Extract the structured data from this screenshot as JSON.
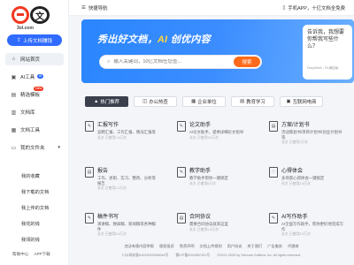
{
  "logo": {
    "mark_text": "文",
    "sub": "3ol.com"
  },
  "sidebar": {
    "upload_label": "上传文档赚钱",
    "items": [
      {
        "label": "网站首页",
        "icon": "home-icon"
      },
      {
        "label": "AI工具",
        "icon": "ai-icon",
        "badge": "AI"
      },
      {
        "label": "精选模板",
        "icon": "template-icon",
        "badge": "New"
      },
      {
        "label": "文档库",
        "icon": "library-icon"
      },
      {
        "label": "文档工具",
        "icon": "tools-icon"
      },
      {
        "label": "我的文件夹",
        "icon": "folder-icon"
      }
    ],
    "sub_items": [
      "我的收藏",
      "我下载的文档",
      "我上传的文档",
      "我花的钱",
      "我领的钱"
    ],
    "footer": [
      "帮助中心",
      "APP下载"
    ]
  },
  "topbar": {
    "left_label": "快捷导航",
    "right_label": "手机APP，十亿文档全免费"
  },
  "banner": {
    "title_a": "秀出好文档，",
    "title_ai": "AI",
    "title_b": " 创优内容",
    "search_placeholder": "输入关键词，10亿文档任您查...",
    "search_button": "搜索",
    "chat_text": "告诉我，我想要你帮我写些什么？",
    "chat_hint": "DeepSeek - R1满血版"
  },
  "tabs": [
    {
      "label": "热门推荐",
      "active": true
    },
    {
      "label": "办公热查",
      "active": false
    },
    {
      "label": "企业单位",
      "active": false
    },
    {
      "label": "教育学习",
      "active": false
    },
    {
      "label": "互联网电商",
      "active": false
    }
  ],
  "cards": [
    {
      "title": "汇报写作",
      "desc": "竞聘汇报、工作汇报、情况汇报等",
      "meta": "长文 已使用1.4万次"
    },
    {
      "title": "论文助手",
      "desc": "AI论文助手，提供详细论文指导",
      "meta": "长文 已使用3.6万次"
    },
    {
      "title": "方案/计划书",
      "desc": "活动策划书/项目计划书/创业计划书等",
      "meta": "长文 已使用1万次"
    },
    {
      "title": "报告",
      "desc": "工作、述职、实习、整改、分析等报告",
      "meta": "长文 已使用1.2万次"
    },
    {
      "title": "教学助手",
      "desc": "教学助手帮你一键搞定",
      "meta": "长文 已使用6万次"
    },
    {
      "title": "心得体会",
      "desc": "多场景心得体会一键搞定",
      "meta": "长文 已使用2.8万次"
    },
    {
      "title": "稿件书写",
      "desc": "演讲稿、致辞稿、新闻稿等各种稿件",
      "meta": "长文 已使用5.6万次"
    },
    {
      "title": "合同协议",
      "desc": "需要合同协议就来这里",
      "meta": "长文 已使用1.8万次"
    },
    {
      "title": "AI写作助手",
      "desc": "AI全面写作助手，帮你更好地完成写作",
      "meta": "长文 已使用3.5万次"
    }
  ],
  "footer": {
    "links": [
      "违法有害内容举报",
      "版权投诉",
      "免责声明",
      "文档上传规则",
      "用户协议",
      "关于我们",
      "广告服务",
      "代理商"
    ],
    "icp": "川公网安备51019002006044号",
    "icp2": "蜀ICP备2024087431号",
    "copyright": "©2021-2026 by Sichuan Solitime Inc. All rights reserved."
  }
}
